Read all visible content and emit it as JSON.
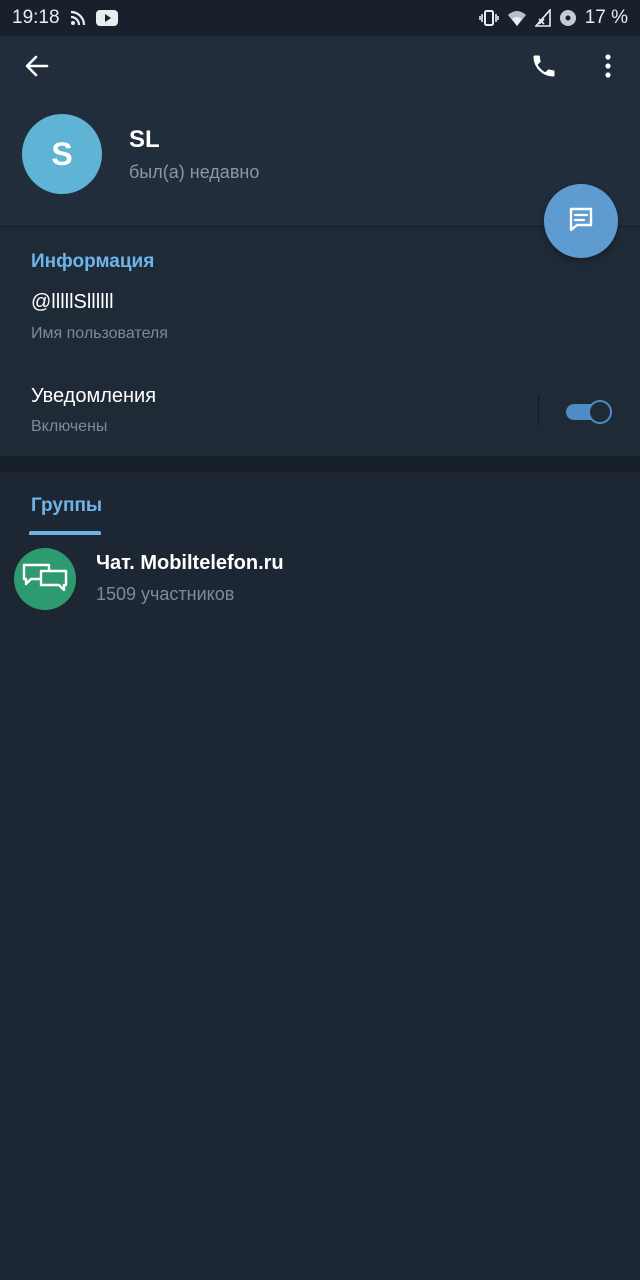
{
  "status_bar": {
    "time": "19:18",
    "battery": "17 %",
    "icons_left": [
      "rss-icon",
      "youtube-icon"
    ],
    "icons_right": [
      "vibrate-icon",
      "wifi-icon",
      "signal-icon",
      "data-saver-icon"
    ]
  },
  "header": {
    "back_icon": "arrow-left-icon",
    "call_icon": "phone-icon",
    "more_icon": "more-vertical-icon"
  },
  "profile": {
    "avatar_letter": "S",
    "avatar_color": "#5fb4d6",
    "name": "SL",
    "status": "был(а) недавно"
  },
  "fab": {
    "icon": "message-icon",
    "color": "#5e9bd1"
  },
  "info": {
    "title": "Информация",
    "username": "@lllllSllllll",
    "username_caption": "Имя пользователя",
    "notifications_label": "Уведомления",
    "notifications_value": "Включены",
    "notifications_enabled": true
  },
  "groups": {
    "tab_label": "Группы",
    "items": [
      {
        "name": "Чат. Mobiltelefon.ru",
        "members": "1509 участников",
        "avatar_color": "#2e9a6f",
        "avatar_icon": "chat-bubbles-icon"
      }
    ]
  },
  "colors": {
    "accent": "#6fb4e8",
    "background": "#1d2733",
    "header_bg": "#212d3b"
  }
}
